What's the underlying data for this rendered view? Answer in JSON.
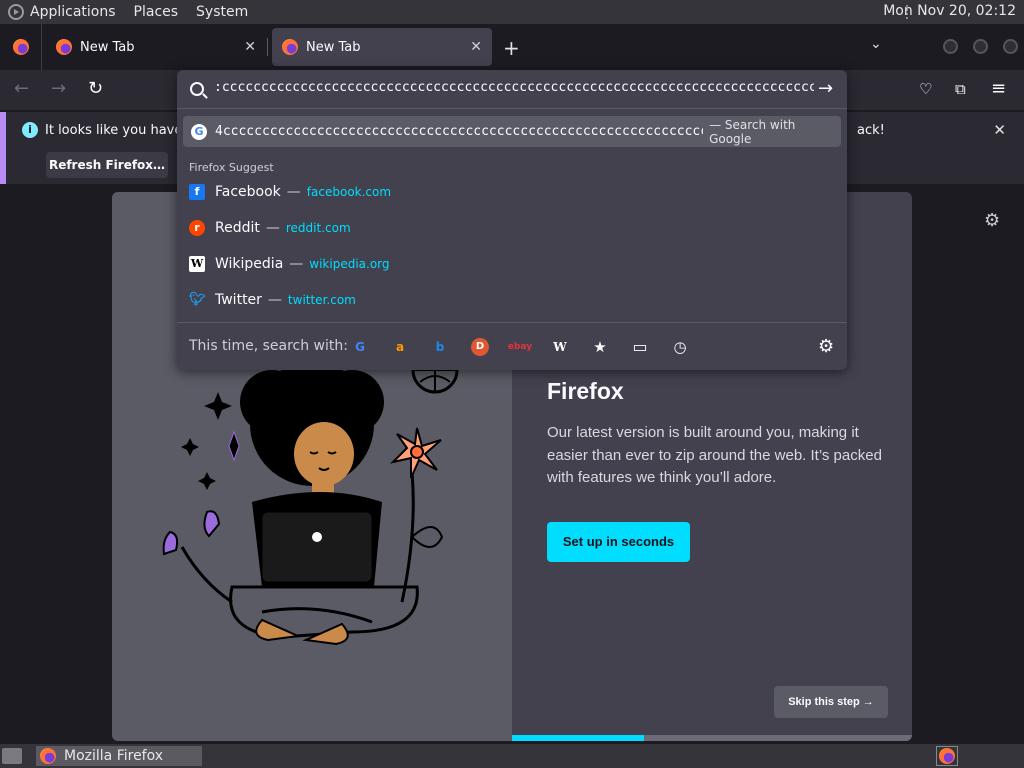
{
  "top_panel": {
    "menus": [
      "Applications",
      "Places",
      "System"
    ],
    "clock": "Mon Nov 20, 02:12"
  },
  "tabs": [
    {
      "label": "New Tab",
      "active": false
    },
    {
      "label": "New Tab",
      "active": true
    }
  ],
  "url_bar": {
    "value": ":cccccccccccccccccccccccccccccccccccccccccccccccccccccccccccccccccccccccccccccccccccccccccc",
    "go_icon": "arrow-right-icon"
  },
  "notification": {
    "message_start": "It looks like you haven't",
    "message_end": "ack!",
    "button_label": "Refresh Firefox…"
  },
  "url_dropdown": {
    "highlighted": {
      "query": "4cccccccccccccccccccccccccccccccccccccccccccccccccccccccccccccccccccccccc",
      "action": "— Search with Google"
    },
    "suggest_heading": "Firefox Suggest",
    "suggestions": [
      {
        "title": "Facebook",
        "url": "facebook.com",
        "icon": "facebook-icon"
      },
      {
        "title": "Reddit",
        "url": "reddit.com",
        "icon": "reddit-icon"
      },
      {
        "title": "Wikipedia",
        "url": "wikipedia.org",
        "icon": "wikipedia-icon"
      },
      {
        "title": "Twitter",
        "url": "twitter.com",
        "icon": "twitter-icon"
      }
    ],
    "oneoff_label": "This time, search with:",
    "engines": [
      "google-icon",
      "amazon-icon",
      "bing-icon",
      "duckduckgo-icon",
      "ebay-icon",
      "wikipedia-icon",
      "bookmarks-icon",
      "tabs-icon",
      "history-icon"
    ],
    "engine_glyphs": {
      "google": "G",
      "amazon": "a",
      "bing": "b",
      "duckduckgo": "D",
      "ebay": "ebay",
      "wikipedia": "W",
      "bookmarks": "★",
      "tabs": "▭",
      "history": "◷"
    }
  },
  "onboarding": {
    "heading": "Firefox",
    "body": "Our latest version is built around you, making it easier than ever to zip around the web. It’s packed with features we think you’ll adore.",
    "primary_button": "Set up in seconds",
    "skip_button": "Skip this step →",
    "progress": 0.33
  },
  "taskbar": {
    "window_label": "Mozilla Firefox"
  },
  "colors": {
    "accent": "#00ddff",
    "panel": "#42414d",
    "background": "#1c1b22"
  }
}
